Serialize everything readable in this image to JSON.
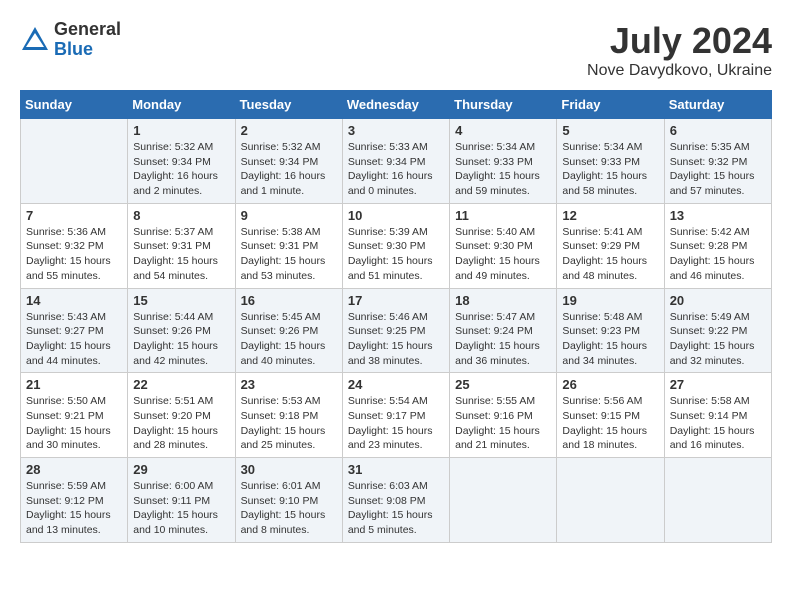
{
  "logo": {
    "general": "General",
    "blue": "Blue"
  },
  "title": "July 2024",
  "location": "Nove Davydkovo, Ukraine",
  "days_of_week": [
    "Sunday",
    "Monday",
    "Tuesday",
    "Wednesday",
    "Thursday",
    "Friday",
    "Saturday"
  ],
  "weeks": [
    [
      {
        "day": "",
        "info": ""
      },
      {
        "day": "1",
        "info": "Sunrise: 5:32 AM\nSunset: 9:34 PM\nDaylight: 16 hours\nand 2 minutes."
      },
      {
        "day": "2",
        "info": "Sunrise: 5:32 AM\nSunset: 9:34 PM\nDaylight: 16 hours\nand 1 minute."
      },
      {
        "day": "3",
        "info": "Sunrise: 5:33 AM\nSunset: 9:34 PM\nDaylight: 16 hours\nand 0 minutes."
      },
      {
        "day": "4",
        "info": "Sunrise: 5:34 AM\nSunset: 9:33 PM\nDaylight: 15 hours\nand 59 minutes."
      },
      {
        "day": "5",
        "info": "Sunrise: 5:34 AM\nSunset: 9:33 PM\nDaylight: 15 hours\nand 58 minutes."
      },
      {
        "day": "6",
        "info": "Sunrise: 5:35 AM\nSunset: 9:32 PM\nDaylight: 15 hours\nand 57 minutes."
      }
    ],
    [
      {
        "day": "7",
        "info": "Sunrise: 5:36 AM\nSunset: 9:32 PM\nDaylight: 15 hours\nand 55 minutes."
      },
      {
        "day": "8",
        "info": "Sunrise: 5:37 AM\nSunset: 9:31 PM\nDaylight: 15 hours\nand 54 minutes."
      },
      {
        "day": "9",
        "info": "Sunrise: 5:38 AM\nSunset: 9:31 PM\nDaylight: 15 hours\nand 53 minutes."
      },
      {
        "day": "10",
        "info": "Sunrise: 5:39 AM\nSunset: 9:30 PM\nDaylight: 15 hours\nand 51 minutes."
      },
      {
        "day": "11",
        "info": "Sunrise: 5:40 AM\nSunset: 9:30 PM\nDaylight: 15 hours\nand 49 minutes."
      },
      {
        "day": "12",
        "info": "Sunrise: 5:41 AM\nSunset: 9:29 PM\nDaylight: 15 hours\nand 48 minutes."
      },
      {
        "day": "13",
        "info": "Sunrise: 5:42 AM\nSunset: 9:28 PM\nDaylight: 15 hours\nand 46 minutes."
      }
    ],
    [
      {
        "day": "14",
        "info": "Sunrise: 5:43 AM\nSunset: 9:27 PM\nDaylight: 15 hours\nand 44 minutes."
      },
      {
        "day": "15",
        "info": "Sunrise: 5:44 AM\nSunset: 9:26 PM\nDaylight: 15 hours\nand 42 minutes."
      },
      {
        "day": "16",
        "info": "Sunrise: 5:45 AM\nSunset: 9:26 PM\nDaylight: 15 hours\nand 40 minutes."
      },
      {
        "day": "17",
        "info": "Sunrise: 5:46 AM\nSunset: 9:25 PM\nDaylight: 15 hours\nand 38 minutes."
      },
      {
        "day": "18",
        "info": "Sunrise: 5:47 AM\nSunset: 9:24 PM\nDaylight: 15 hours\nand 36 minutes."
      },
      {
        "day": "19",
        "info": "Sunrise: 5:48 AM\nSunset: 9:23 PM\nDaylight: 15 hours\nand 34 minutes."
      },
      {
        "day": "20",
        "info": "Sunrise: 5:49 AM\nSunset: 9:22 PM\nDaylight: 15 hours\nand 32 minutes."
      }
    ],
    [
      {
        "day": "21",
        "info": "Sunrise: 5:50 AM\nSunset: 9:21 PM\nDaylight: 15 hours\nand 30 minutes."
      },
      {
        "day": "22",
        "info": "Sunrise: 5:51 AM\nSunset: 9:20 PM\nDaylight: 15 hours\nand 28 minutes."
      },
      {
        "day": "23",
        "info": "Sunrise: 5:53 AM\nSunset: 9:18 PM\nDaylight: 15 hours\nand 25 minutes."
      },
      {
        "day": "24",
        "info": "Sunrise: 5:54 AM\nSunset: 9:17 PM\nDaylight: 15 hours\nand 23 minutes."
      },
      {
        "day": "25",
        "info": "Sunrise: 5:55 AM\nSunset: 9:16 PM\nDaylight: 15 hours\nand 21 minutes."
      },
      {
        "day": "26",
        "info": "Sunrise: 5:56 AM\nSunset: 9:15 PM\nDaylight: 15 hours\nand 18 minutes."
      },
      {
        "day": "27",
        "info": "Sunrise: 5:58 AM\nSunset: 9:14 PM\nDaylight: 15 hours\nand 16 minutes."
      }
    ],
    [
      {
        "day": "28",
        "info": "Sunrise: 5:59 AM\nSunset: 9:12 PM\nDaylight: 15 hours\nand 13 minutes."
      },
      {
        "day": "29",
        "info": "Sunrise: 6:00 AM\nSunset: 9:11 PM\nDaylight: 15 hours\nand 10 minutes."
      },
      {
        "day": "30",
        "info": "Sunrise: 6:01 AM\nSunset: 9:10 PM\nDaylight: 15 hours\nand 8 minutes."
      },
      {
        "day": "31",
        "info": "Sunrise: 6:03 AM\nSunset: 9:08 PM\nDaylight: 15 hours\nand 5 minutes."
      },
      {
        "day": "",
        "info": ""
      },
      {
        "day": "",
        "info": ""
      },
      {
        "day": "",
        "info": ""
      }
    ]
  ]
}
